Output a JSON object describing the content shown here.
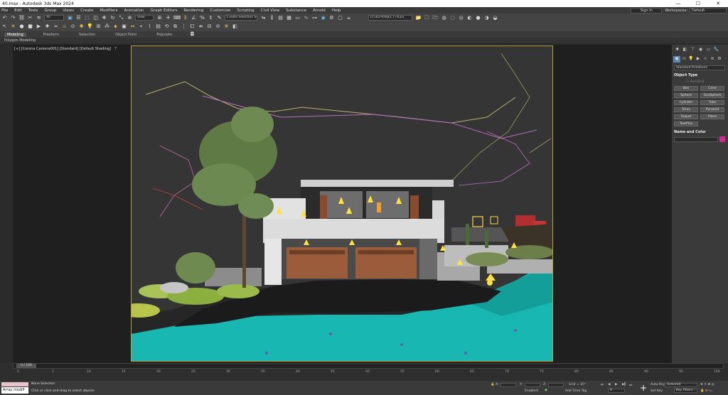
{
  "window": {
    "title": "40.max - Autodesk 3ds Max 2024",
    "minimize": "—",
    "maximize": "☐",
    "close": "✕"
  },
  "menu": {
    "items": [
      "File",
      "Edit",
      "Tools",
      "Group",
      "Views",
      "Create",
      "Modifiers",
      "Animation",
      "Graph Editors",
      "Rendering",
      "Customize",
      "Scripting",
      "Civil View",
      "Substance",
      "Arnold",
      "Help"
    ],
    "sign_in": "Sign In",
    "workspaces_label": "Workspaces:",
    "workspaces_value": "Default"
  },
  "toolbar": {
    "selection_filter": "All",
    "reference_coord": "View",
    "named_selection": "Create Selection Se",
    "project_path": "D:\\3D PORJECT FILES"
  },
  "ribbon": {
    "tabs": [
      "Modeling",
      "Freeform",
      "Selection",
      "Object Paint",
      "Populate"
    ],
    "active": "Modeling",
    "sub_label": "Polygon Modeling"
  },
  "viewport": {
    "label": "[+] [Corona Camera001] [Standard] [Default Shading]",
    "filter_symbol": "⊤"
  },
  "command_panel": {
    "dropdown": "Standard Primitives",
    "object_type_title": "Object Type",
    "autogrid": "AutoGrid",
    "buttons": [
      "Box",
      "Cone",
      "Sphere",
      "GeoSphere",
      "Cylinder",
      "Tube",
      "Torus",
      "Pyramid",
      "Teapot",
      "Plane",
      "TextPlus"
    ],
    "name_color_title": "Name and Color",
    "object_color": "#cc2a8e"
  },
  "timeline": {
    "frame_display": "0 / 100",
    "ticks": [
      "0",
      "5",
      "10",
      "15",
      "20",
      "25",
      "30",
      "35",
      "40",
      "45",
      "50",
      "55",
      "60",
      "65",
      "70",
      "75",
      "80",
      "85",
      "90",
      "95",
      "100"
    ]
  },
  "status": {
    "maxscript": "Array modifi",
    "selection_info": "None Selected",
    "prompt": "Click or click-and-drag to select objects",
    "x_label": "X:",
    "y_label": "Y:",
    "z_label": "Z:",
    "grid": "Grid = 10\"",
    "enabled": "Enabled:",
    "add_time_tag": "Add Time Tag",
    "auto_key": "Auto Key",
    "set_key": "Set Key",
    "selected": "Selected",
    "key_filters": "Key Filters...",
    "frame": "0"
  }
}
